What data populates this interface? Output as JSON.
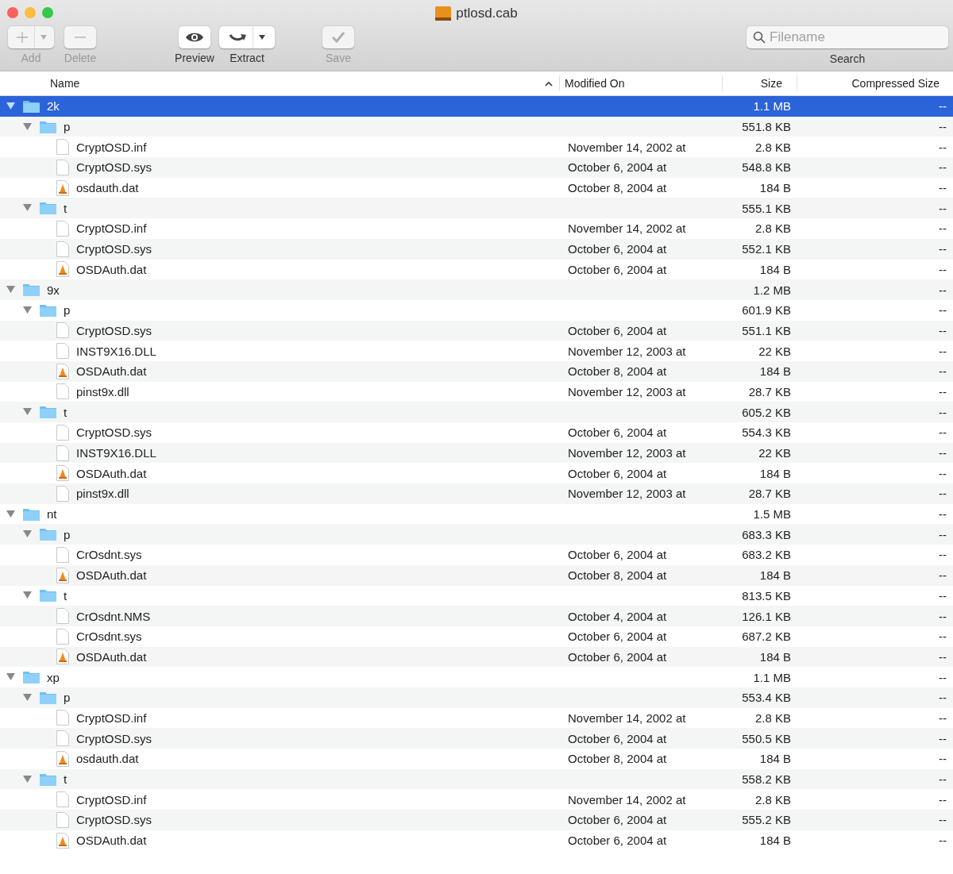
{
  "window": {
    "title": "ptlosd.cab"
  },
  "toolbar": [
    {
      "label": "Add",
      "kind": "add",
      "disabled": true,
      "menu": true
    },
    {
      "label": "Delete",
      "kind": "delete",
      "disabled": true,
      "menu": false
    },
    {
      "label": "Preview",
      "kind": "preview",
      "disabled": false,
      "menu": false
    },
    {
      "label": "Extract",
      "kind": "extract",
      "disabled": false,
      "menu": true
    },
    {
      "label": "Save",
      "kind": "save",
      "disabled": true,
      "menu": false
    }
  ],
  "search": {
    "placeholder": "Filename",
    "label": "Search"
  },
  "columns": [
    {
      "label": "Name",
      "sorted": true
    },
    {
      "label": "Modified On",
      "sorted": false
    },
    {
      "label": "Size",
      "sorted": false
    },
    {
      "label": "Compressed Size",
      "sorted": false
    }
  ],
  "tree": [
    {
      "name": "2k",
      "kind": "folder",
      "expanded": true,
      "selected": true,
      "size": "1.1 MB",
      "compressed": "--",
      "children": [
        {
          "name": "p",
          "kind": "folder",
          "expanded": true,
          "selected": false,
          "size": "551.8 KB",
          "compressed": "--",
          "children": [
            {
              "name": "CryptOSD.inf",
              "kind": "file",
              "selected": false,
              "modified": "November 14, 2002 at",
              "size": "2.8 KB",
              "compressed": "--"
            },
            {
              "name": "CryptOSD.sys",
              "kind": "file",
              "selected": false,
              "modified": "October 6, 2004 at",
              "size": "548.8 KB",
              "compressed": "--"
            },
            {
              "name": "osdauth.dat",
              "kind": "media",
              "selected": false,
              "modified": "October 8, 2004 at",
              "size": "184 B",
              "compressed": "--"
            }
          ]
        },
        {
          "name": "t",
          "kind": "folder",
          "expanded": true,
          "selected": false,
          "size": "555.1 KB",
          "compressed": "--",
          "children": [
            {
              "name": "CryptOSD.inf",
              "kind": "file",
              "selected": false,
              "modified": "November 14, 2002 at",
              "size": "2.8 KB",
              "compressed": "--"
            },
            {
              "name": "CryptOSD.sys",
              "kind": "file",
              "selected": false,
              "modified": "October 6, 2004 at",
              "size": "552.1 KB",
              "compressed": "--"
            },
            {
              "name": "OSDAuth.dat",
              "kind": "media",
              "selected": false,
              "modified": "October 6, 2004 at",
              "size": "184 B",
              "compressed": "--"
            }
          ]
        }
      ]
    },
    {
      "name": "9x",
      "kind": "folder",
      "expanded": true,
      "selected": false,
      "size": "1.2 MB",
      "compressed": "--",
      "children": [
        {
          "name": "p",
          "kind": "folder",
          "expanded": true,
          "selected": false,
          "size": "601.9 KB",
          "compressed": "--",
          "children": [
            {
              "name": "CryptOSD.sys",
              "kind": "file",
              "selected": false,
              "modified": "October 6, 2004 at",
              "size": "551.1 KB",
              "compressed": "--"
            },
            {
              "name": "INST9X16.DLL",
              "kind": "file",
              "selected": false,
              "modified": "November 12, 2003 at",
              "size": "22 KB",
              "compressed": "--"
            },
            {
              "name": "OSDAuth.dat",
              "kind": "media",
              "selected": false,
              "modified": "October 8, 2004 at",
              "size": "184 B",
              "compressed": "--"
            },
            {
              "name": "pinst9x.dll",
              "kind": "file",
              "selected": false,
              "modified": "November 12, 2003 at",
              "size": "28.7 KB",
              "compressed": "--"
            }
          ]
        },
        {
          "name": "t",
          "kind": "folder",
          "expanded": true,
          "selected": false,
          "size": "605.2 KB",
          "compressed": "--",
          "children": [
            {
              "name": "CryptOSD.sys",
              "kind": "file",
              "selected": false,
              "modified": "October 6, 2004 at",
              "size": "554.3 KB",
              "compressed": "--"
            },
            {
              "name": "INST9X16.DLL",
              "kind": "file",
              "selected": false,
              "modified": "November 12, 2003 at",
              "size": "22 KB",
              "compressed": "--"
            },
            {
              "name": "OSDAuth.dat",
              "kind": "media",
              "selected": false,
              "modified": "October 6, 2004 at",
              "size": "184 B",
              "compressed": "--"
            },
            {
              "name": "pinst9x.dll",
              "kind": "file",
              "selected": false,
              "modified": "November 12, 2003 at",
              "size": "28.7 KB",
              "compressed": "--"
            }
          ]
        }
      ]
    },
    {
      "name": "nt",
      "kind": "folder",
      "expanded": true,
      "selected": false,
      "size": "1.5 MB",
      "compressed": "--",
      "children": [
        {
          "name": "p",
          "kind": "folder",
          "expanded": true,
          "selected": false,
          "size": "683.3 KB",
          "compressed": "--",
          "children": [
            {
              "name": "CrOsdnt.sys",
              "kind": "file",
              "selected": false,
              "modified": "October 6, 2004 at",
              "size": "683.2 KB",
              "compressed": "--"
            },
            {
              "name": "OSDAuth.dat",
              "kind": "media",
              "selected": false,
              "modified": "October 8, 2004 at",
              "size": "184 B",
              "compressed": "--"
            }
          ]
        },
        {
          "name": "t",
          "kind": "folder",
          "expanded": true,
          "selected": false,
          "size": "813.5 KB",
          "compressed": "--",
          "children": [
            {
              "name": "CrOsdnt.NMS",
              "kind": "file",
              "selected": false,
              "modified": "October 4, 2004 at",
              "size": "126.1 KB",
              "compressed": "--"
            },
            {
              "name": "CrOsdnt.sys",
              "kind": "file",
              "selected": false,
              "modified": "October 6, 2004 at",
              "size": "687.2 KB",
              "compressed": "--"
            },
            {
              "name": "OSDAuth.dat",
              "kind": "media",
              "selected": false,
              "modified": "October 6, 2004 at",
              "size": "184 B",
              "compressed": "--"
            }
          ]
        }
      ]
    },
    {
      "name": "xp",
      "kind": "folder",
      "expanded": true,
      "selected": false,
      "size": "1.1 MB",
      "compressed": "--",
      "children": [
        {
          "name": "p",
          "kind": "folder",
          "expanded": true,
          "selected": false,
          "size": "553.4 KB",
          "compressed": "--",
          "children": [
            {
              "name": "CryptOSD.inf",
              "kind": "file",
              "selected": false,
              "modified": "November 14, 2002 at",
              "size": "2.8 KB",
              "compressed": "--"
            },
            {
              "name": "CryptOSD.sys",
              "kind": "file",
              "selected": false,
              "modified": "October 6, 2004 at",
              "size": "550.5 KB",
              "compressed": "--"
            },
            {
              "name": "osdauth.dat",
              "kind": "media",
              "selected": false,
              "modified": "October 8, 2004 at",
              "size": "184 B",
              "compressed": "--"
            }
          ]
        },
        {
          "name": "t",
          "kind": "folder",
          "expanded": true,
          "selected": false,
          "size": "558.2 KB",
          "compressed": "--",
          "children": [
            {
              "name": "CryptOSD.inf",
              "kind": "file",
              "selected": false,
              "modified": "November 14, 2002 at",
              "size": "2.8 KB",
              "compressed": "--"
            },
            {
              "name": "CryptOSD.sys",
              "kind": "file",
              "selected": false,
              "modified": "October 6, 2004 at",
              "size": "555.2 KB",
              "compressed": "--"
            },
            {
              "name": "OSDAuth.dat",
              "kind": "media",
              "selected": false,
              "modified": "October 6, 2004 at",
              "size": "184 B",
              "compressed": "--"
            }
          ]
        }
      ]
    }
  ]
}
